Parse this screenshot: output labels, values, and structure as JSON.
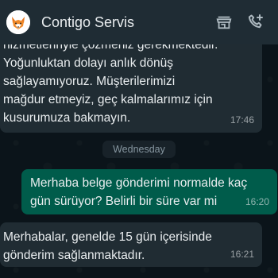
{
  "header": {
    "contact_name": "Contigo Servis",
    "avatar_icon": "fox-logo-avatar",
    "actions": [
      {
        "icon": "store-icon"
      },
      {
        "icon": "add-call-icon"
      }
    ]
  },
  "messages": [
    {
      "direction": "incoming",
      "text": "hizmetlerinyle çözmeniz gerekmektedir.\nYoğunluktan dolayı anlık dönüş\nsağlayamıyoruz. Müşterilerimizi\nmağdur etmeyiz, geç kalmalarımız için\nkusurumuza bakmayın.",
      "time": "17:46"
    },
    {
      "direction": "outgoing",
      "text": "Merhaba belge gönderimi normalde kaç\ngün sürüyor? Belirli bir süre var mi",
      "time": "16:20"
    },
    {
      "direction": "incoming",
      "text": "Merhabalar, genelde 15 gün içerisinde\ngönderim sağlanmaktadır.",
      "time": "16:21"
    }
  ],
  "date_separator": "Wednesday",
  "colors": {
    "header_bg": "#1f2c34",
    "chat_bg": "#0b141a",
    "incoming_bubble": "#202c33",
    "outgoing_bubble": "#005c4b",
    "text": "#e9edef",
    "meta_text": "#8696a0"
  }
}
